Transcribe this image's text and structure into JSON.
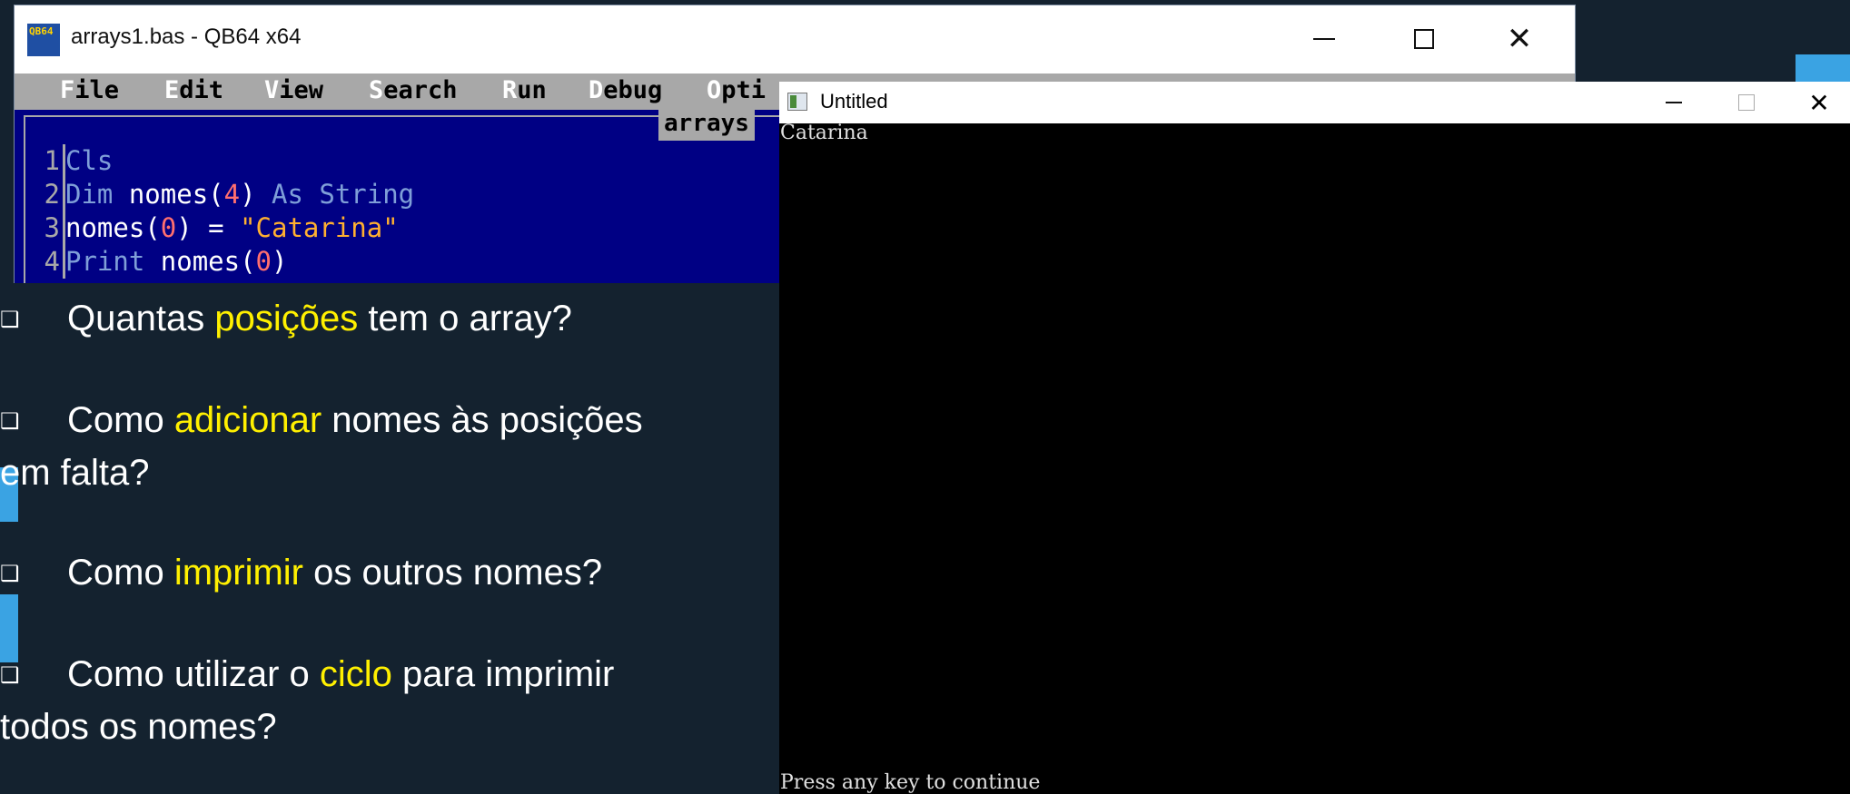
{
  "qb64": {
    "title": "arrays1.bas - QB64 x64",
    "logo_text": "QB64",
    "menu": [
      "File",
      "Edit",
      "View",
      "Search",
      "Run",
      "Debug",
      "Opti"
    ],
    "file_tab": "arrays",
    "code_lines": [
      {
        "no": "1",
        "text": "Cls"
      },
      {
        "no": "2",
        "text": "Dim nomes(4) As String"
      },
      {
        "no": "3",
        "text": "nomes(0) = \"Catarina\""
      },
      {
        "no": "4",
        "text": "Print nomes(0)"
      }
    ]
  },
  "console": {
    "title": "Untitled",
    "output": "Catarina",
    "prompt": "Press any key to continue"
  },
  "slide": {
    "questions": [
      {
        "bullet": "❑",
        "before": "Quantas ",
        "highlight": "posições",
        "after": " tem o array?"
      },
      {
        "bullet": "❑",
        "before": "Como ",
        "highlight": "adicionar",
        "after": " nomes às posições",
        "line2": "em falta?"
      },
      {
        "bullet": "❑",
        "before": "Como ",
        "highlight": "imprimir",
        "after": " os outros nomes?"
      },
      {
        "bullet": "❑",
        "before": "Como utilizar o ",
        "highlight": "ciclo",
        "after": " para imprimir",
        "line2": "todos os nomes?"
      }
    ]
  },
  "colors": {
    "slide_background": "#14222f",
    "highlight": "#fff000",
    "accent": "#3aa3e3",
    "qb_background": "#000084"
  },
  "icons": [
    "qb64-app-icon",
    "console-app-icon",
    "minimize-icon",
    "maximize-icon",
    "close-icon"
  ]
}
